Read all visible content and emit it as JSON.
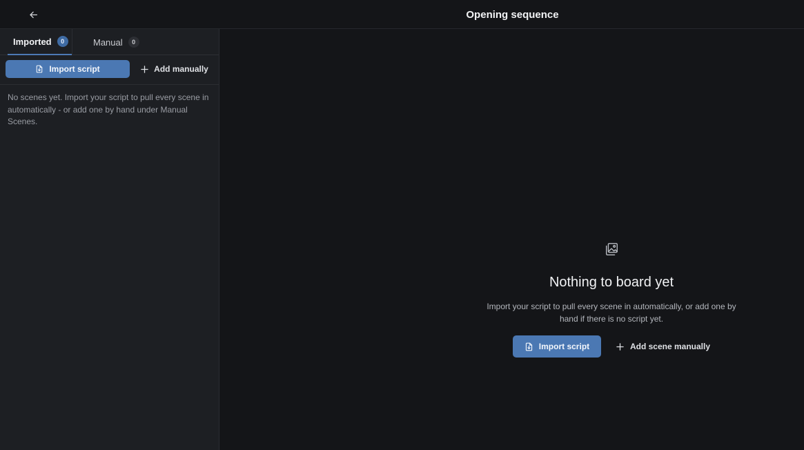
{
  "header": {
    "title": "Opening sequence",
    "back_icon": "arrow-left-icon"
  },
  "sidebar": {
    "tabs": [
      {
        "label": "Imported",
        "count": "0",
        "active": true
      },
      {
        "label": "Manual",
        "count": "0",
        "active": false
      }
    ],
    "import_label": "Import script",
    "add_label": "Add manually",
    "empty_text": "No scenes yet. Import your script to pull every scene in automatically - or add one by hand under Manual Scenes."
  },
  "main": {
    "icon": "image-gallery-icon",
    "title": "Nothing to board yet",
    "description": "Import your script to pull every scene in automatically, or add one by hand if there is no script yet.",
    "import_label": "Import script",
    "add_label": "Add scene manually"
  },
  "colors": {
    "accent": "#4b78b3",
    "sidebar_bg": "#1d1f23",
    "main_bg": "#141518"
  }
}
